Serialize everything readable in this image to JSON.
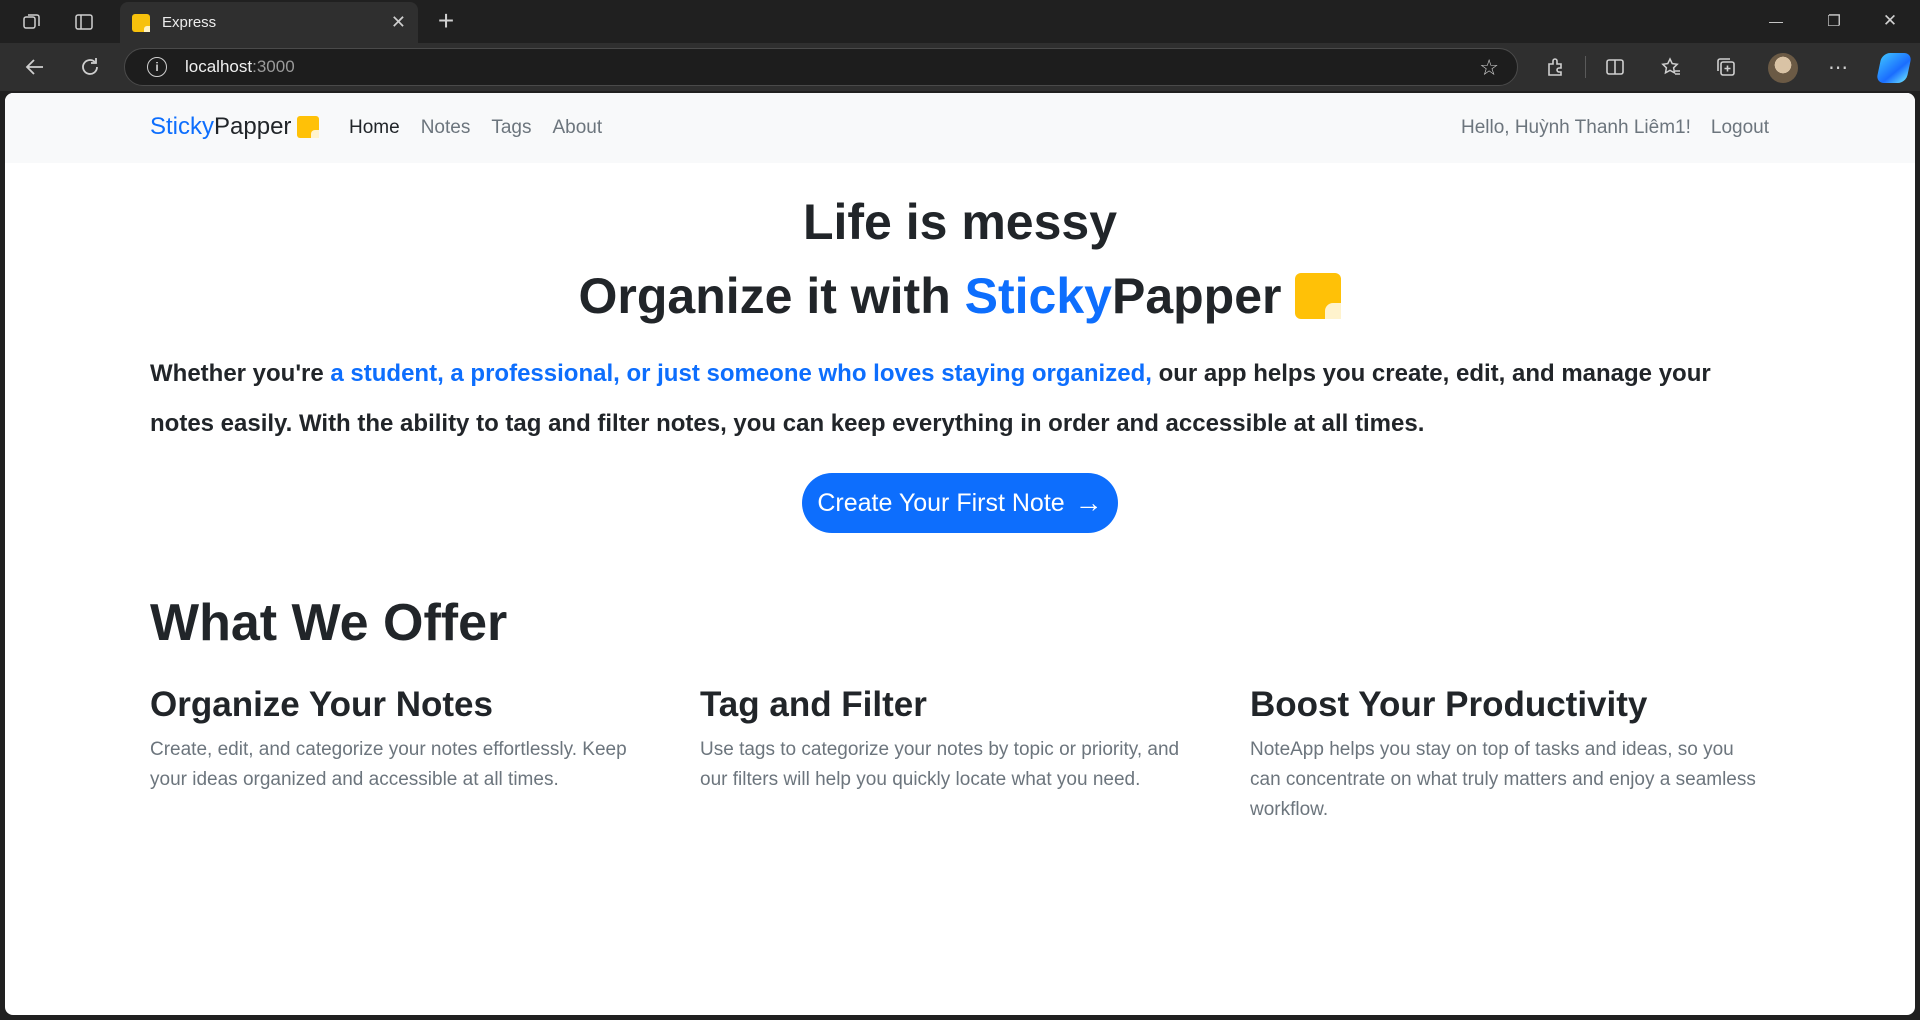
{
  "browser": {
    "tab_title": "Express",
    "tab_close": "✕",
    "new_tab": "+",
    "url_host": "localhost",
    "url_port": ":3000",
    "info_glyph": "i",
    "window_controls": [
      "—",
      "❐",
      "✕"
    ]
  },
  "nav": {
    "brand_part1": "Sticky",
    "brand_part2": "Papper",
    "links": [
      "Home",
      "Notes",
      "Tags",
      "About"
    ],
    "greeting": "Hello, Huỳnh Thanh Liêm1!",
    "logout": "Logout"
  },
  "hero": {
    "line1": "Life is messy",
    "line2_prefix": "Organize it with ",
    "brand_part1": "Sticky",
    "brand_part2": "Papper"
  },
  "intro": {
    "part1": "Whether you're ",
    "highlight": "a student, a professional, or just someone who loves staying organized,",
    "part2": " our app helps you create, edit, and manage your notes easily. With the ability to tag and filter notes, you can keep everything in order and accessible at all times."
  },
  "cta": {
    "label": "Create Your First Note",
    "arrow": "→"
  },
  "offer": {
    "title": "What We Offer",
    "features": [
      {
        "title": "Organize Your Notes",
        "text": "Create, edit, and categorize your notes effortlessly. Keep your ideas organized and accessible at all times."
      },
      {
        "title": "Tag and Filter",
        "text": "Use tags to categorize your notes by topic or priority, and our filters will help you quickly locate what you need."
      },
      {
        "title": "Boost Your Productivity",
        "text": "NoteApp helps you stay on top of tasks and ideas, so you can concentrate on what truly matters and enjoy a seamless workflow."
      }
    ]
  },
  "colors": {
    "primary": "#0d6efd",
    "accent_yellow": "#ffc107",
    "text_dark": "#212529",
    "text_muted": "#6c757d",
    "navbar_bg": "#f8f9fa"
  }
}
